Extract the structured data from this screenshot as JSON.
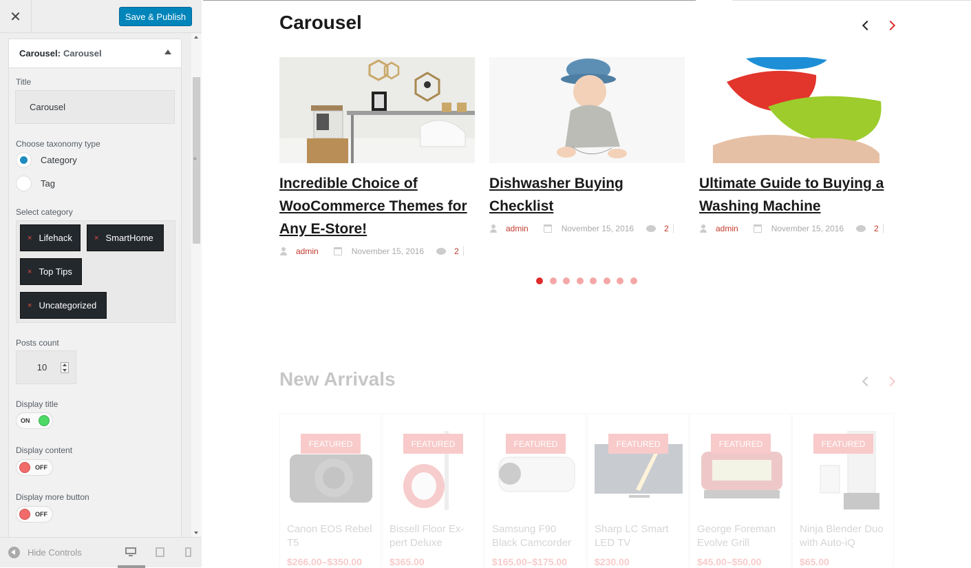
{
  "customizer": {
    "close_label": "✕",
    "publish_label": "Save & Publish",
    "section": {
      "title": "Carousel:",
      "subtitle": "Carousel"
    },
    "title_label": "Title",
    "title_value": "Carousel",
    "taxonomy_label": "Choose taxonomy type",
    "taxonomy_options": [
      "Category",
      "Tag"
    ],
    "taxonomy_selected": "Category",
    "category_label": "Select category",
    "categories": [
      "Lifehack",
      "SmartHome",
      "Top Tips",
      "Uncategorized"
    ],
    "posts_count_label": "Posts count",
    "posts_count_value": "10",
    "display_title_label": "Display title",
    "display_title_state": "ON",
    "display_content_label": "Display content",
    "display_content_state": "OFF",
    "display_more_label": "Display more button",
    "display_more_state": "OFF",
    "hide_controls_label": "Hide Controls",
    "remove_glyph": "×"
  },
  "preview": {
    "carousel_title": "Carousel",
    "posts": [
      {
        "title": "Incredible Choice of WooCommerce Themes for Any E-Store!",
        "author": "admin",
        "date": "November 15, 2016",
        "comments": "2"
      },
      {
        "title": "Dishwasher Buying Checklist",
        "author": "admin",
        "date": "November 15, 2016",
        "comments": "2"
      },
      {
        "title": "Ultimate Guide to Buying a Washing Machine",
        "author": "admin",
        "date": "November 15, 2016",
        "comments": "2"
      }
    ],
    "dots_total": 8,
    "active_dot": 1,
    "arrivals_title": "New Arrivals",
    "products": [
      {
        "badge": "FEATURED",
        "name": "Canon EOS Rebel T5",
        "price": "$266.00–$350.00"
      },
      {
        "badge": "FEATURED",
        "name": "Bissell Floor Ex-pert Deluxe",
        "price": "$365.00"
      },
      {
        "badge": "FEATURED",
        "name": "Samsung F90 Black Camcorder",
        "price": "$165.00–$175.00"
      },
      {
        "badge": "FEATURED",
        "name": "Sharp LC Smart LED TV",
        "price": "$230.00"
      },
      {
        "badge": "FEATURED",
        "name": "George Foreman Evolve Grill",
        "price": "$45.00–$50.00"
      },
      {
        "badge": "FEATURED",
        "name": "Ninja Blender Duo with Auto-iQ",
        "price": "$65.00"
      }
    ]
  },
  "colors": {
    "accent": "#e02b2b",
    "publish": "#0085ba",
    "tag_bg": "#23282d"
  }
}
